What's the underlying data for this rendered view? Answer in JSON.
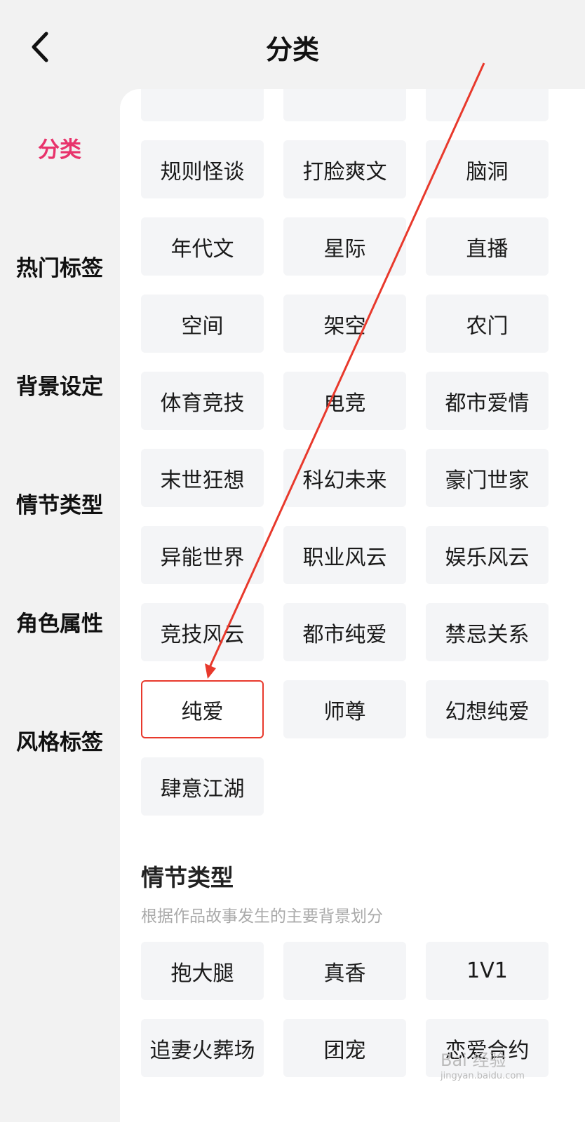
{
  "header": {
    "title": "分类"
  },
  "sidebar": {
    "items": [
      {
        "label": "分类",
        "active": true
      },
      {
        "label": "热门标签"
      },
      {
        "label": "背景设定"
      },
      {
        "label": "情节类型"
      },
      {
        "label": "角色属性"
      },
      {
        "label": "风格标签"
      }
    ]
  },
  "style_tags": [
    "规则怪谈",
    "打脸爽文",
    "脑洞",
    "年代文",
    "星际",
    "直播",
    "空间",
    "架空",
    "农门",
    "体育竞技",
    "电竞",
    "都市爱情",
    "末世狂想",
    "科幻未来",
    "豪门世家",
    "异能世界",
    "职业风云",
    "娱乐风云",
    "竞技风云",
    "都市纯爱",
    "禁忌关系",
    "纯爱",
    "师尊",
    "幻想纯爱",
    "肆意江湖"
  ],
  "plot_section": {
    "title": "情节类型",
    "description": "根据作品故事发生的主要背景划分",
    "tags": [
      "抱大腿",
      "真香",
      "1V1",
      "追妻火葬场",
      "团宠",
      "恋爱合约"
    ]
  },
  "watermark": {
    "text": "Bai 经验",
    "sub": "jingyan.baidu.com"
  },
  "colors": {
    "accent": "#e8336b",
    "annotation": "#e8392c",
    "tag_bg": "#f4f5f7"
  }
}
